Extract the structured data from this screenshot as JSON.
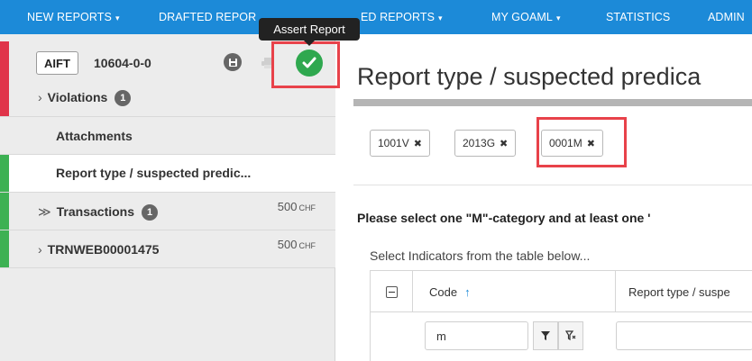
{
  "nav": {
    "items": [
      {
        "label": "NEW REPORTS",
        "caret": "▾"
      },
      {
        "label": "DRAFTED REPOR"
      },
      {
        "label": "ED REPORTS",
        "caret": "▾"
      },
      {
        "label": "MY GOAML",
        "caret": "▾"
      },
      {
        "label": "STATISTICS"
      },
      {
        "label": "ADMIN"
      }
    ]
  },
  "tooltip": {
    "text": "Assert Report"
  },
  "sidebar": {
    "report_type": "AIFT",
    "report_id": "10604-0-0",
    "rows": [
      {
        "label": "Violations",
        "chevron": "›",
        "badge": "1",
        "status": "red"
      },
      {
        "label": "Attachments",
        "status": "none"
      },
      {
        "label": "Report type / suspected predic...",
        "status": "green",
        "active": true
      },
      {
        "label": "Transactions",
        "chevron": "≫",
        "badge": "1",
        "amount": "500",
        "currency": "CHF",
        "status": "green"
      },
      {
        "label": "TRNWEB00001475",
        "chevron": "›",
        "amount": "500",
        "currency": "CHF",
        "status": "green"
      }
    ]
  },
  "main": {
    "title": "Report type / suspected predica",
    "tags": [
      {
        "label": "1001V"
      },
      {
        "label": "2013G"
      },
      {
        "label": "0001M"
      }
    ],
    "instructions": "Please select one \"M\"-category and at least one '",
    "hint": "Select Indicators from the table below...",
    "table": {
      "columns": [
        "Code",
        "Report type / suspe"
      ],
      "sort_indicator": "↑",
      "filter_value": "m"
    }
  },
  "colors": {
    "nav_bg": "#1c8ad8",
    "status_red": "#e0344a",
    "status_green": "#3db153",
    "assert_green": "#2fa84f",
    "highlight": "#e8424a"
  }
}
